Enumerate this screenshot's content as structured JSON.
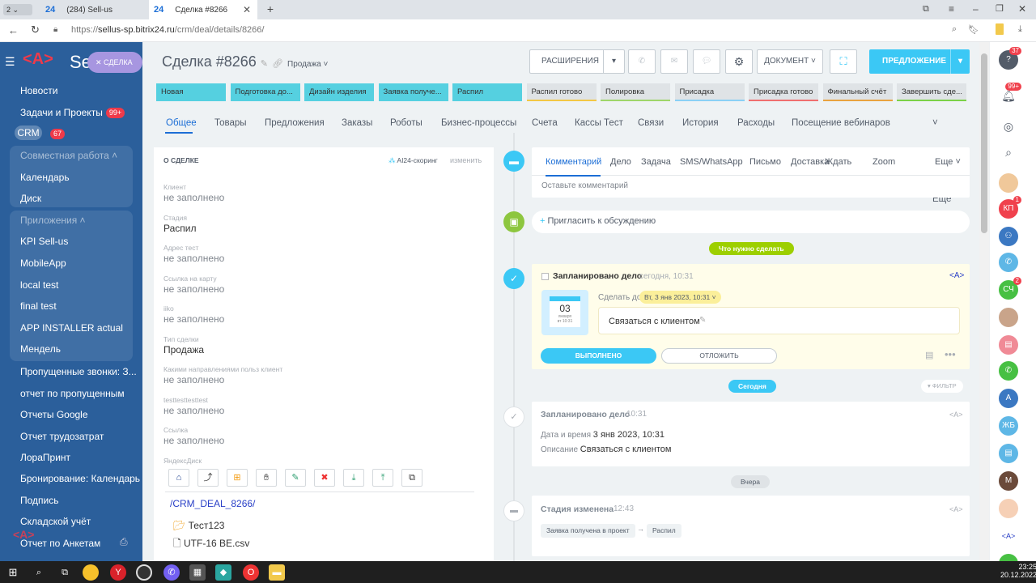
{
  "browser": {
    "tabs": [
      {
        "favicon": "24",
        "title": "(284) Sell-us"
      },
      {
        "favicon": "24",
        "title": "Сделка #8266"
      }
    ],
    "tab_counter": "2",
    "url_prefix": "https://",
    "url_host": "sellus-sp.bitrix24.ru",
    "url_path": "/crm/deal/details/8266/"
  },
  "sidebar": {
    "logo": "Se",
    "close_label": "СДЕЛКА",
    "items": [
      {
        "label": "Новости"
      },
      {
        "label": "Задачи и Проекты",
        "badge": "99+"
      },
      {
        "label": "CRM",
        "badge": "67"
      },
      {
        "label": "Совместная работа"
      },
      {
        "label": "Календарь"
      },
      {
        "label": "Диск"
      },
      {
        "label": "Приложения"
      },
      {
        "label": "KPI Sell-us"
      },
      {
        "label": "MobileApp"
      },
      {
        "label": "local test"
      },
      {
        "label": "final test"
      },
      {
        "label": "APP INSTALLER actual"
      },
      {
        "label": "Мендель"
      },
      {
        "label": "Пропущенные звонки: З..."
      },
      {
        "label": "отчет по пропущенным"
      },
      {
        "label": "Отчеты Google"
      },
      {
        "label": "Отчет трудозатрат"
      },
      {
        "label": "ЛораПринт"
      },
      {
        "label": "Бронирование: Календарь"
      },
      {
        "label": "Подпись"
      },
      {
        "label": "Складской учёт"
      },
      {
        "label": "Отчет по Анкетам"
      }
    ]
  },
  "deal": {
    "title": "Сделка #8266",
    "category": "Продажа",
    "buttons": {
      "extensions": "РАСШИРЕНИЯ",
      "document": "ДОКУМЕНТ",
      "proposal": "ПРЕДЛОЖЕНИЕ"
    },
    "stages": [
      {
        "label": "Новая",
        "active": true
      },
      {
        "label": "Подготовка до...",
        "active": true
      },
      {
        "label": "Дизайн изделия",
        "active": true
      },
      {
        "label": "Заявка получе...",
        "active": true
      },
      {
        "label": "Распил",
        "active": true
      },
      {
        "label": "Распил готово",
        "active": false,
        "color": "#f3c744"
      },
      {
        "label": "Полировка",
        "active": false,
        "color": "#9fd66b"
      },
      {
        "label": "Присадка",
        "active": false,
        "color": "#8ad0f5"
      },
      {
        "label": "Присадка готово",
        "active": false,
        "color": "#ef6f6f"
      },
      {
        "label": "Финальный счёт",
        "active": false,
        "color": "#e9a340"
      },
      {
        "label": "Завершить сде...",
        "active": false,
        "color": "#7bd148"
      }
    ],
    "tabs": [
      "Общее",
      "Товары",
      "Предложения",
      "Заказы",
      "Роботы",
      "Бизнес-процессы",
      "Счета",
      "Кассы Тест",
      "Связи",
      "История",
      "Расходы",
      "Посещение вебинаров",
      "Еще"
    ]
  },
  "about": {
    "heading": "О СДЕЛКЕ",
    "scoring": "AI24-скоринг",
    "edit": "изменить",
    "fields": [
      {
        "label": "Клиент",
        "value": "не заполнено"
      },
      {
        "label": "Стадия",
        "value": "Распил"
      },
      {
        "label": "Адрес тест",
        "value": "не заполнено"
      },
      {
        "label": "Ссылка на карту",
        "value": "не заполнено"
      },
      {
        "label": "iiko",
        "value": "не заполнено"
      },
      {
        "label": "Тип сделки",
        "value": "Продажа"
      },
      {
        "label": "Какими направлениями польз клиент",
        "value": "не заполнено"
      },
      {
        "label": "testtesttesttest",
        "value": "не заполнено"
      },
      {
        "label": "Ссылка",
        "value": "не заполнено"
      }
    ],
    "disk_label": "ЯндексДиск",
    "disk_path": "/CRM_DEAL_8266/",
    "disk_folder": "Тест123",
    "disk_file": "UTF-16 BE.csv"
  },
  "timeline": {
    "tabs": [
      "Комментарий",
      "Дело",
      "Задача",
      "SMS/WhatsApp",
      "Письмо",
      "Доставка",
      "Ждать",
      "Zoom",
      "Еще"
    ],
    "comment_placeholder": "Оставьте комментарий",
    "invite": "Пригласить к обсуждению",
    "todo_badge": "Что нужно сделать",
    "planned": {
      "title": "Запланировано дело",
      "time": "сегодня, 10:31",
      "deadline_label": "Сделать до",
      "deadline": "Вт, 3 янв 2023, 10:31",
      "cal_day": "03",
      "cal_month": "января",
      "cal_time": "вт 10:31",
      "text": "Связаться с клиентом",
      "done": "ВЫПОЛНЕНО",
      "postpone": "ОТЛОЖИТЬ"
    },
    "today_badge": "Сегодня",
    "filter": "ФИЛЬТР",
    "history1": {
      "title": "Запланировано дело",
      "time": "10:31",
      "date_label": "Дата и время",
      "date": "3 янв 2023, 10:31",
      "desc_label": "Описание",
      "desc": "Связаться с клиентом"
    },
    "yesterday_badge": "Вчера",
    "history2": {
      "title": "Стадия изменена",
      "time": "12:43",
      "from": "Заявка получена в проект",
      "to": "Распил"
    }
  },
  "rightbar": {
    "badges": [
      "37",
      "99+",
      "1",
      "2"
    ],
    "labels": [
      "КП",
      "СЧ",
      "ЖБ",
      "М"
    ]
  },
  "taskbar": {
    "time": "23:25",
    "date": "20.12.2022"
  }
}
